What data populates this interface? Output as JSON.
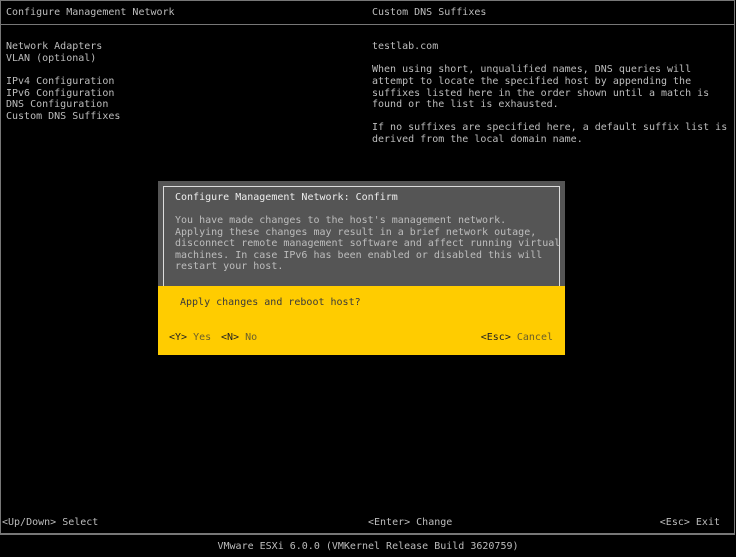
{
  "left_panel": {
    "title": "Configure Management Network",
    "items": [
      {
        "label": "Network Adapters"
      },
      {
        "label": "VLAN (optional)"
      },
      {
        "label": "IPv4 Configuration"
      },
      {
        "label": "IPv6 Configuration"
      },
      {
        "label": "DNS Configuration"
      },
      {
        "label": "Custom DNS Suffixes"
      }
    ]
  },
  "right_panel": {
    "title": "Custom DNS Suffixes",
    "value": "testlab.com",
    "description1": [
      "When using short, unqualified names, DNS queries will",
      "attempt to locate the specified host by appending the",
      "suffixes listed here in the order shown until a match is",
      "found or the list is exhausted."
    ],
    "description2": [
      "If no suffixes are specified here, a default suffix list is",
      "derived from the local domain name."
    ]
  },
  "dialog": {
    "title": "Configure Management Network: Confirm",
    "body": [
      "You have made changes to the host's management network.",
      "Applying these changes may result in a brief network outage,",
      "disconnect remote management software and affect running virtual",
      "machines. In case IPv6 has been enabled or disabled this will",
      "restart your host."
    ],
    "question": "Apply changes and reboot host?",
    "yes_key": "<Y>",
    "yes_label": "Yes",
    "no_key": "<N>",
    "no_label": "No",
    "cancel_key": "<Esc>",
    "cancel_label": "Cancel"
  },
  "footer": {
    "select": "<Up/Down> Select",
    "change": "<Enter> Change",
    "exit": "<Esc> Exit",
    "version": "VMware ESXi 6.0.0 (VMKernel Release Build 3620759)"
  },
  "colors": {
    "background": "#000000",
    "dialog_gray": "#555555",
    "dialog_yellow": "#ffcc00",
    "text": "#bdbdbd"
  }
}
